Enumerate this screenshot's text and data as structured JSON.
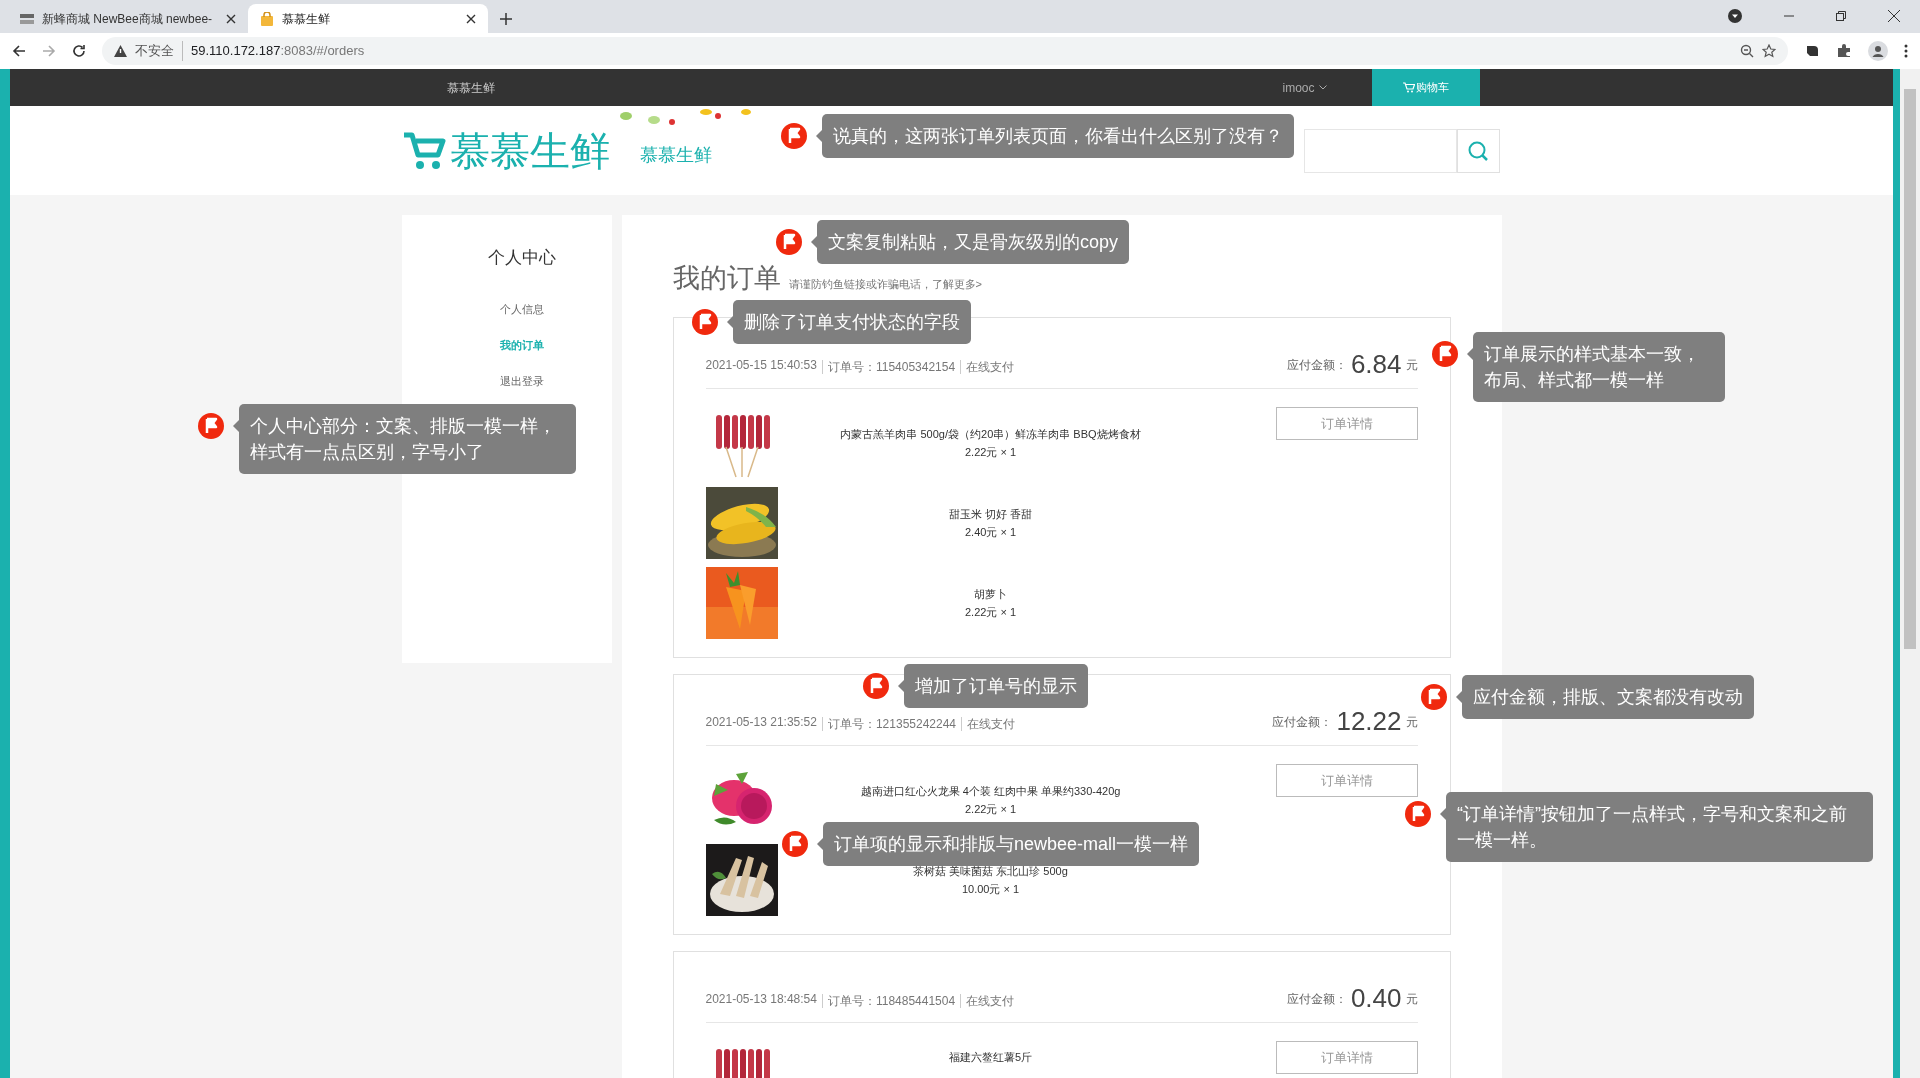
{
  "browser": {
    "tabs": [
      {
        "title": "新蜂商城 NewBee商城 newbee-",
        "selected": false,
        "kind": "newbee"
      },
      {
        "title": "慕慕生鲜",
        "selected": true,
        "kind": "bag"
      }
    ],
    "address": {
      "security": "不安全",
      "host": "59.110.172.187",
      "rest": ":8083/#/orders"
    }
  },
  "nav": {
    "brand": "慕慕生鲜",
    "user": "imooc",
    "cart": "购物车"
  },
  "header": {
    "logo": "慕慕生鲜",
    "logo_small": "慕慕生鲜"
  },
  "sidebar": {
    "title": "个人中心",
    "items": [
      {
        "label": "个人信息",
        "selected": false
      },
      {
        "label": "我的订单",
        "selected": true
      },
      {
        "label": "退出登录",
        "selected": false
      }
    ]
  },
  "orders": {
    "title": "我的订单",
    "notice": "请谨防钓鱼链接或诈骗电话，了解更多>",
    "list": [
      {
        "time": "2021-05-15 15:40:53",
        "order_no": "订单号：115405342154",
        "pay_type": "在线支付",
        "amount_label": "应付金额：",
        "amount": "6.84",
        "currency": "元",
        "button": "订单详情",
        "items": [
          {
            "name": "内蒙古羔羊肉串 500g/袋（约20串）鲜冻羊肉串 BBQ烧烤食材",
            "price": "2.22元 × 1"
          },
          {
            "name": "甜玉米 切好 香甜",
            "price": "2.40元 × 1"
          },
          {
            "name": "胡萝卜",
            "price": "2.22元 × 1"
          }
        ]
      },
      {
        "time": "2021-05-13 21:35:52",
        "order_no": "订单号：121355242244",
        "pay_type": "在线支付",
        "amount_label": "应付金额：",
        "amount": "12.22",
        "currency": "元",
        "button": "订单详情",
        "items": [
          {
            "name": "越南进口红心火龙果 4个装 红肉中果 单果约330-420g",
            "price": "2.22元 × 1"
          },
          {
            "name": "茶树菇 美味菌菇 东北山珍 500g",
            "price": "10.00元 × 1"
          }
        ]
      },
      {
        "time": "2021-05-13 18:48:54",
        "order_no": "订单号：118485441504",
        "pay_type": "在线支付",
        "amount_label": "应付金额：",
        "amount": "0.40",
        "currency": "元",
        "button": "订单详情",
        "items": [
          {
            "name": "福建六鳌红薯5斤"
          }
        ]
      }
    ]
  },
  "annotations": [
    {
      "text": "说真的，这两张订单列表页面，你看出什么区别了没有？"
    },
    {
      "text": "文案复制粘贴，又是骨灰级别的copy"
    },
    {
      "text": "删除了订单支付状态的字段"
    },
    {
      "text": "订单展示的样式基本一致，布局、样式都一模一样"
    },
    {
      "text": "个人中心部分：文案、排版一模一样，样式有一点点区别，字号小了"
    },
    {
      "text": "增加了订单号的显示"
    },
    {
      "text": "应付金额，排版、文案都没有改动"
    },
    {
      "text": "订单项的显示和排版与newbee-mall一模一样"
    },
    {
      "text": "“订单详情”按钮加了一点样式，字号和文案和之前一模一样。"
    }
  ]
}
